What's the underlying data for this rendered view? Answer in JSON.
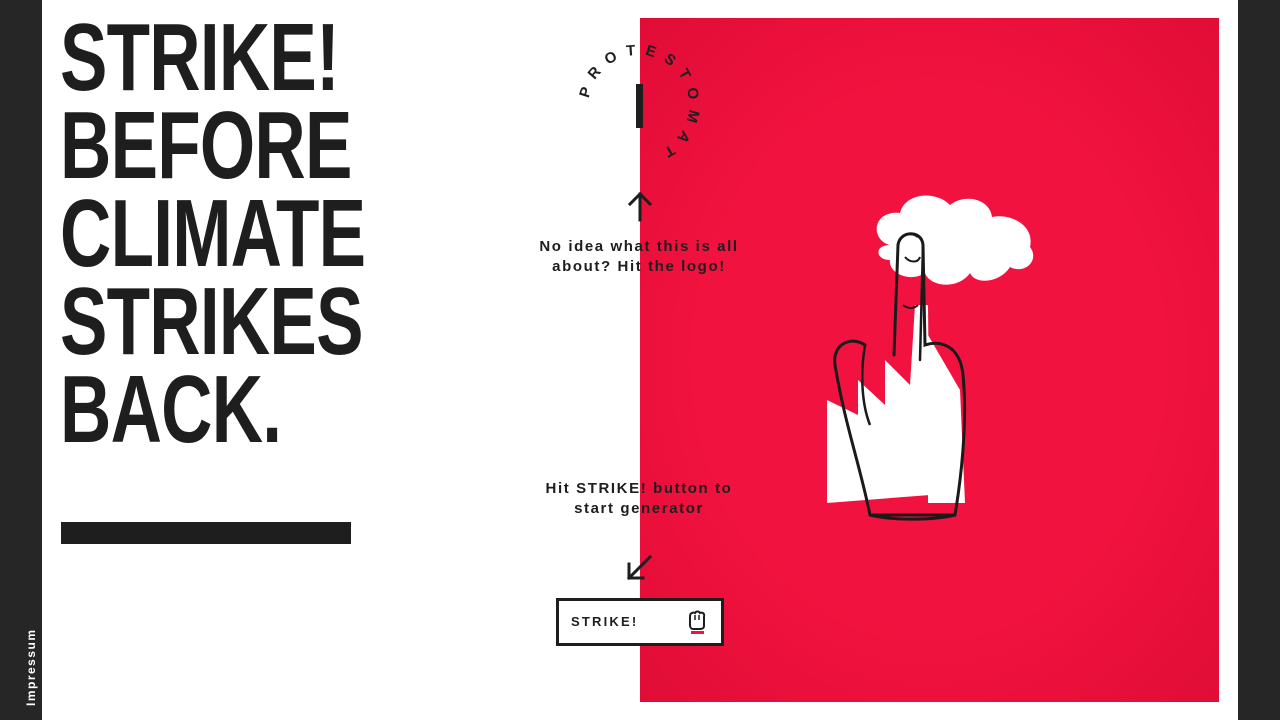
{
  "sidebar": {
    "impressum_label": "Impressum"
  },
  "headline": {
    "lines": [
      "STRIKE!",
      "BEFORE",
      "CLIMATE",
      "STRIKES",
      "BACK."
    ]
  },
  "logo": {
    "text": "PROTESTOMAT"
  },
  "hints": {
    "logo_hint": "No idea what this is all about? Hit the logo!",
    "strike_hint": "Hit STRIKE! button to start generator"
  },
  "strike_button": {
    "label": "STRIKE!"
  },
  "colors": {
    "accent": "#f2123f",
    "dark": "#1e1e1e",
    "background": "#ffffff"
  },
  "icons": {
    "logo": "protestomat-circular-logo",
    "up": "arrow-up-icon",
    "down": "arrow-down-left-icon",
    "fist": "fist-icon",
    "hero": "factory-finger-illustration"
  }
}
